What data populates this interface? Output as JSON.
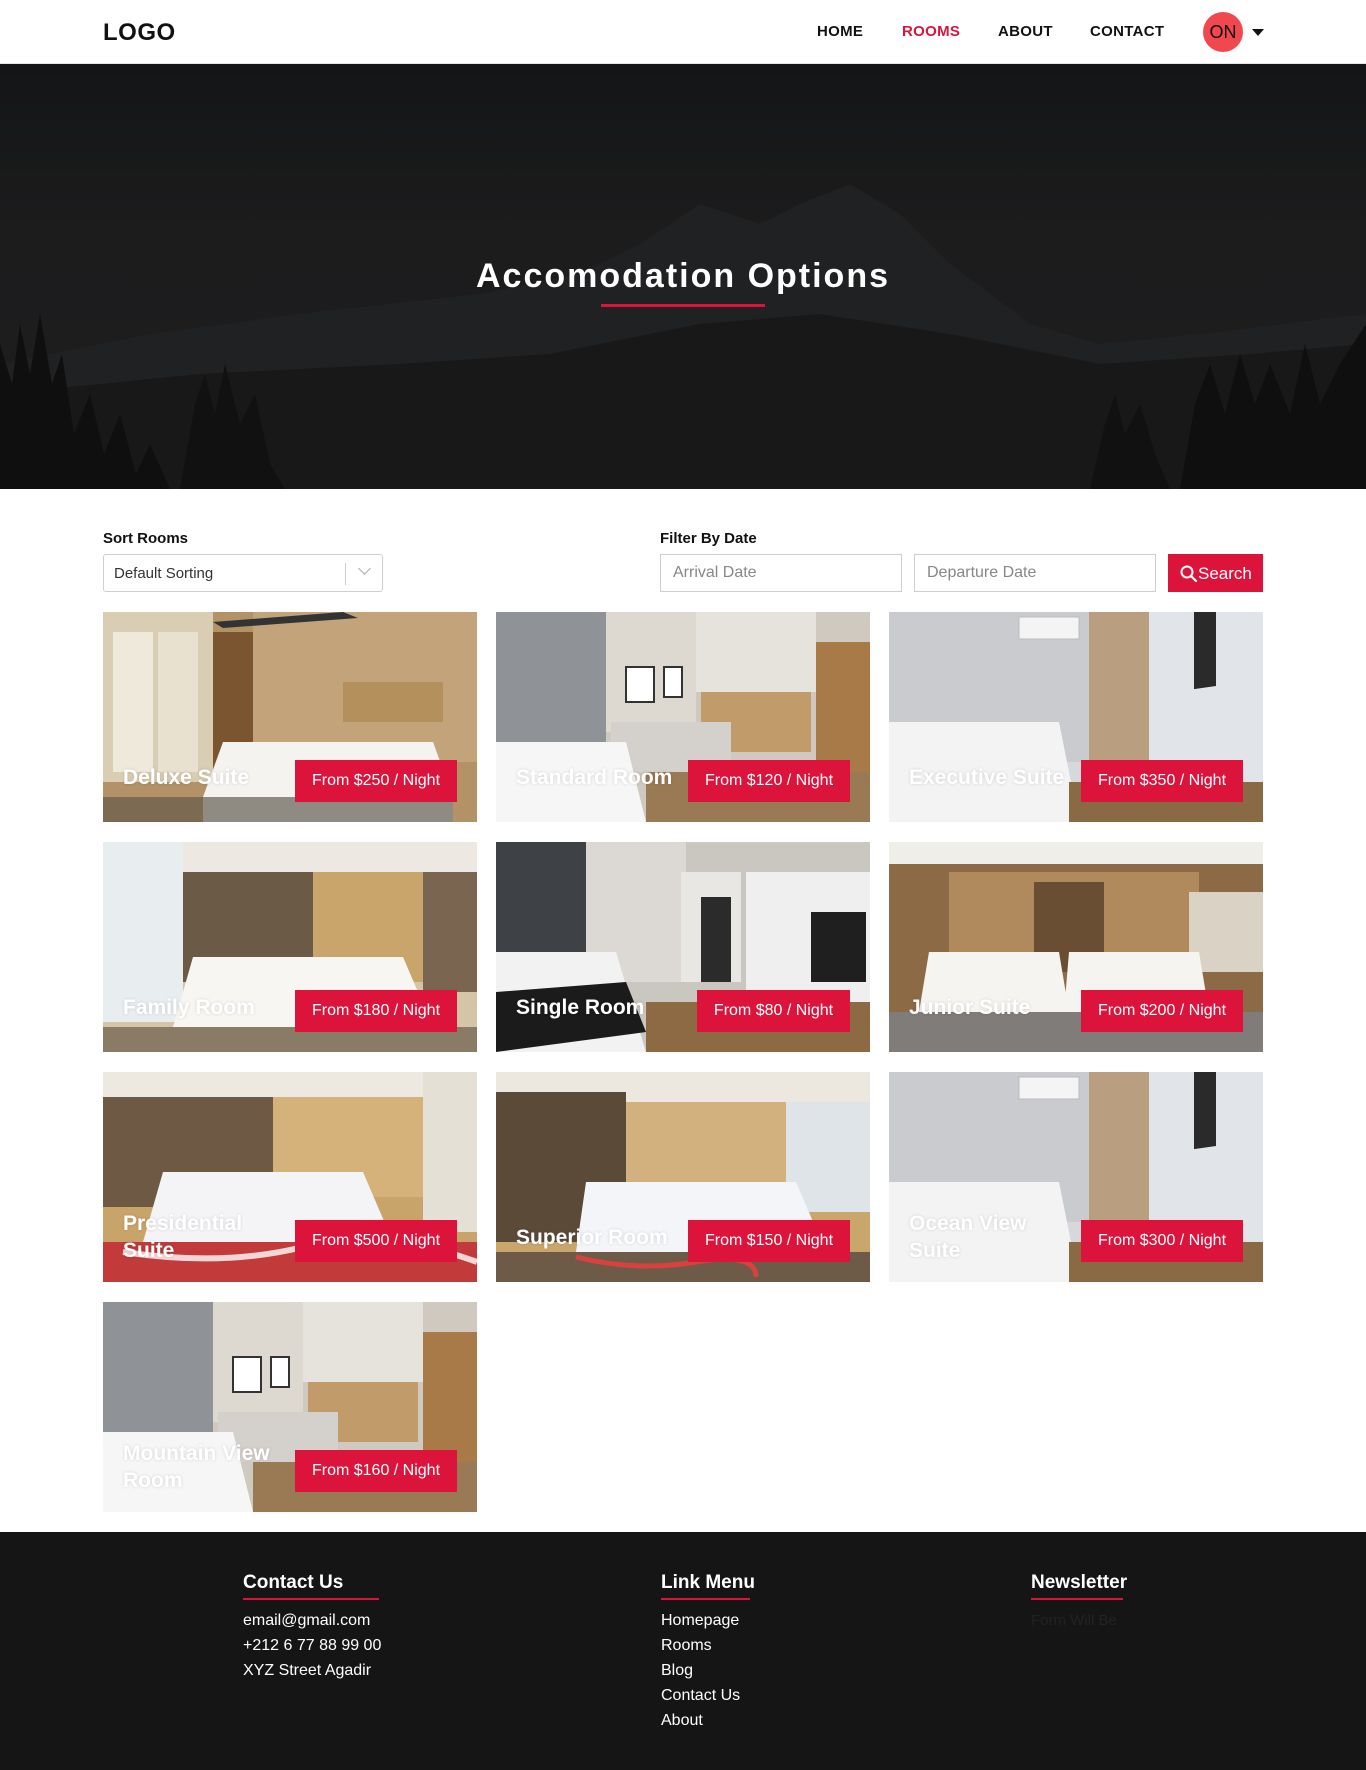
{
  "navbar": {
    "logo": "LOGO",
    "links": [
      "HOME",
      "ROOMS",
      "ABOUT",
      "CONTACT"
    ],
    "active_link": "ROOMS",
    "avatar_text": "ON"
  },
  "hero": {
    "title": "Accomodation Options"
  },
  "filters": {
    "sort_label": "Sort Rooms",
    "sort_value": "Default Sorting",
    "date_label": "Filter By Date",
    "arrival_placeholder": "Arrival Date",
    "departure_placeholder": "Departure Date",
    "search_label": "Search"
  },
  "rooms": [
    {
      "name": "Deluxe Suite",
      "price": "From $250 / Night"
    },
    {
      "name": "Standard Room",
      "price": "From $120 / Night"
    },
    {
      "name": "Executive Suite",
      "price": "From $350 / Night"
    },
    {
      "name": "Family Room",
      "price": "From $180 / Night"
    },
    {
      "name": "Single Room",
      "price": "From $80 / Night"
    },
    {
      "name": "Junior Suite",
      "price": "From $200 / Night"
    },
    {
      "name": "Presidential Suite",
      "price": "From $500 / Night"
    },
    {
      "name": "Superior Room",
      "price": "From $150 / Night"
    },
    {
      "name": "Ocean View Suite",
      "price": "From $300 / Night"
    },
    {
      "name": "Mountain View Room",
      "price": "From $160 / Night"
    }
  ],
  "footer": {
    "contact": {
      "title": "Contact Us",
      "items": [
        "email@gmail.com",
        "+212 6 77 88 99 00",
        "XYZ Street Agadir"
      ]
    },
    "links": {
      "title": "Link Menu",
      "items": [
        "Homepage",
        "Rooms",
        "Blog",
        "Contact Us",
        "About"
      ]
    },
    "newsletter": {
      "title": "Newsletter",
      "text": "Form Will Be"
    }
  },
  "colors": {
    "accent": "#dc143c",
    "avatar": "#f0484e",
    "footer_bg": "#151515"
  }
}
